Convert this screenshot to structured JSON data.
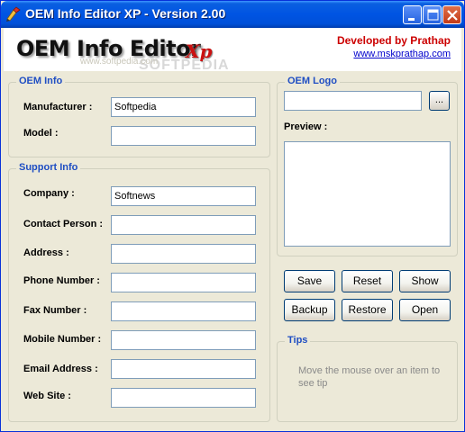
{
  "window": {
    "title": "OEM Info Editor XP - Version 2.00"
  },
  "header": {
    "logo_main": "OEM Info Editor",
    "logo_suffix": "Xp",
    "developed_by": "Developed by Prathap",
    "website_link": "www.mskprathap.com",
    "watermark": "SOFTPEDIA",
    "watermark_url": "www.softpedia.com"
  },
  "oem_info": {
    "title": "OEM Info",
    "manufacturer_label": "Manufacturer :",
    "manufacturer_value": "Softpedia",
    "model_label": "Model :",
    "model_value": ""
  },
  "support_info": {
    "title": "Support Info",
    "company_label": "Company :",
    "company_value": "Softnews",
    "contact_label": "Contact Person :",
    "contact_value": "",
    "address_label": "Address :",
    "address_value": "",
    "phone_label": "Phone Number :",
    "phone_value": "",
    "fax_label": "Fax Number :",
    "fax_value": "",
    "mobile_label": "Mobile Number :",
    "mobile_value": "",
    "email_label": "Email Address :",
    "email_value": "",
    "website_label": "Web Site :",
    "website_value": ""
  },
  "oem_logo": {
    "title": "OEM Logo",
    "path_value": "",
    "browse_label": "...",
    "preview_label": "Preview :"
  },
  "buttons": {
    "save": "Save",
    "reset": "Reset",
    "show": "Show",
    "backup": "Backup",
    "restore": "Restore",
    "open": "Open"
  },
  "tips": {
    "title": "Tips",
    "text": "Move the mouse over an item to see tip"
  },
  "colors": {
    "title_bar": "#0054e3",
    "group_title": "#1f4ec3",
    "developer_text": "#cc0000",
    "link": "#0000cc"
  }
}
